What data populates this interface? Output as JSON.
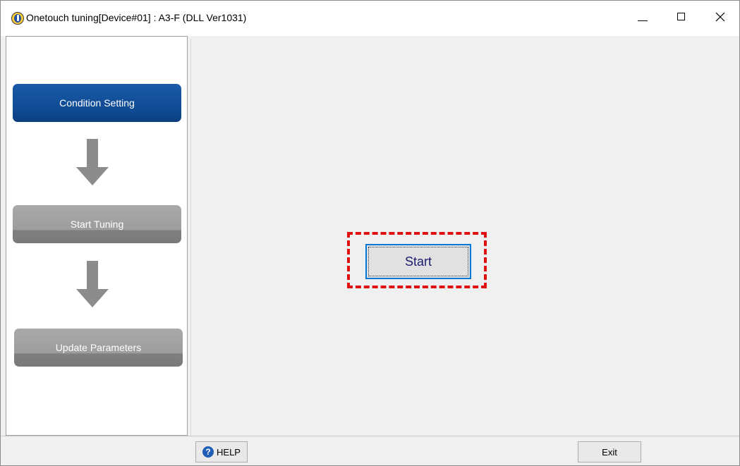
{
  "window": {
    "title": "Onetouch tuning[Device#01]  : A3-F (DLL Ver1031)"
  },
  "steps": [
    {
      "label": "Condition Setting",
      "state": "active"
    },
    {
      "label": "Start Tuning",
      "state": "inactive"
    },
    {
      "label": "Update Parameters",
      "state": "inactive"
    }
  ],
  "main": {
    "start_label": "Start"
  },
  "footer": {
    "help_label": "HELP",
    "help_icon_glyph": "?",
    "exit_label": "Exit"
  },
  "colors": {
    "active_step": "#0f4a93",
    "inactive_step": "#9d9d9d",
    "highlight": "#e01010",
    "focus": "#0078d7"
  }
}
